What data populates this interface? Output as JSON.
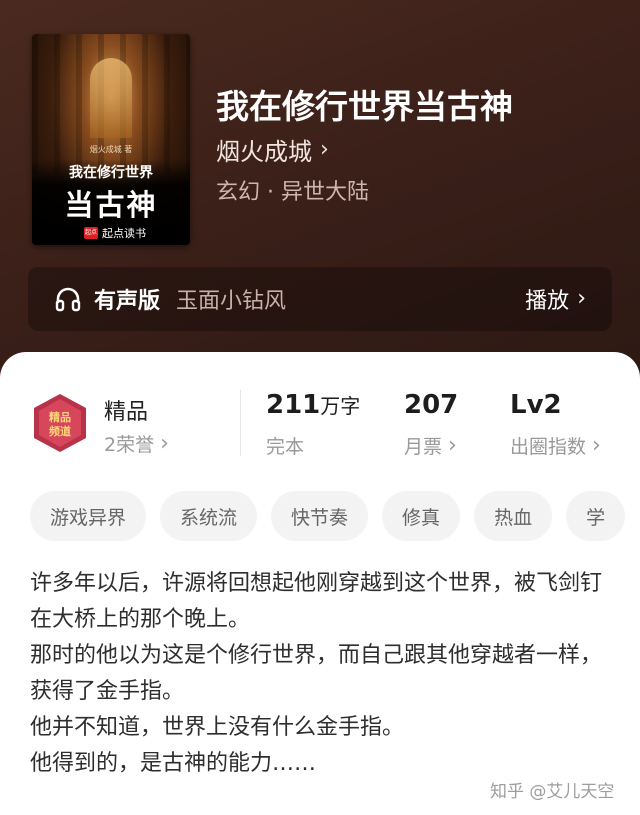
{
  "book": {
    "title": "我在修行世界当古神",
    "author": "烟火成城",
    "genre": "玄幻 · 异世大陆",
    "cover": {
      "author_small": "烟火成城 著",
      "title_line1": "我在修行世界",
      "title_line2": "当古神",
      "logo_text": "起点",
      "publisher": "起点读书"
    }
  },
  "audio": {
    "label": "有声版",
    "narrator": "玉面小钻风",
    "action": "播放"
  },
  "stats": {
    "quality": {
      "label": "精品",
      "sub": "2荣誉",
      "badge_text": "精品频道"
    },
    "words": {
      "value": "211",
      "unit": "万字",
      "sub": "完本"
    },
    "tickets": {
      "value": "207",
      "sub": "月票"
    },
    "level": {
      "value": "Lv2",
      "sub": "出圈指数"
    }
  },
  "tags": [
    "游戏异界",
    "系统流",
    "快节奏",
    "修真",
    "热血",
    "学"
  ],
  "description": [
    "许多年以后，许源将回想起他刚穿越到这个世界，被飞剑钉在大桥上的那个晚上。",
    "那时的他以为这是个修行世界，而自己跟其他穿越者一样，获得了金手指。",
    "他并不知道，世界上没有什么金手指。",
    "他得到的，是古神的能力……"
  ],
  "watermark": "知乎 @艾儿天空",
  "colors": {
    "hero_bg": "#3b2019",
    "badge_red": "#b8324a",
    "text_dark": "#1d1d1d",
    "text_muted": "#999999"
  }
}
